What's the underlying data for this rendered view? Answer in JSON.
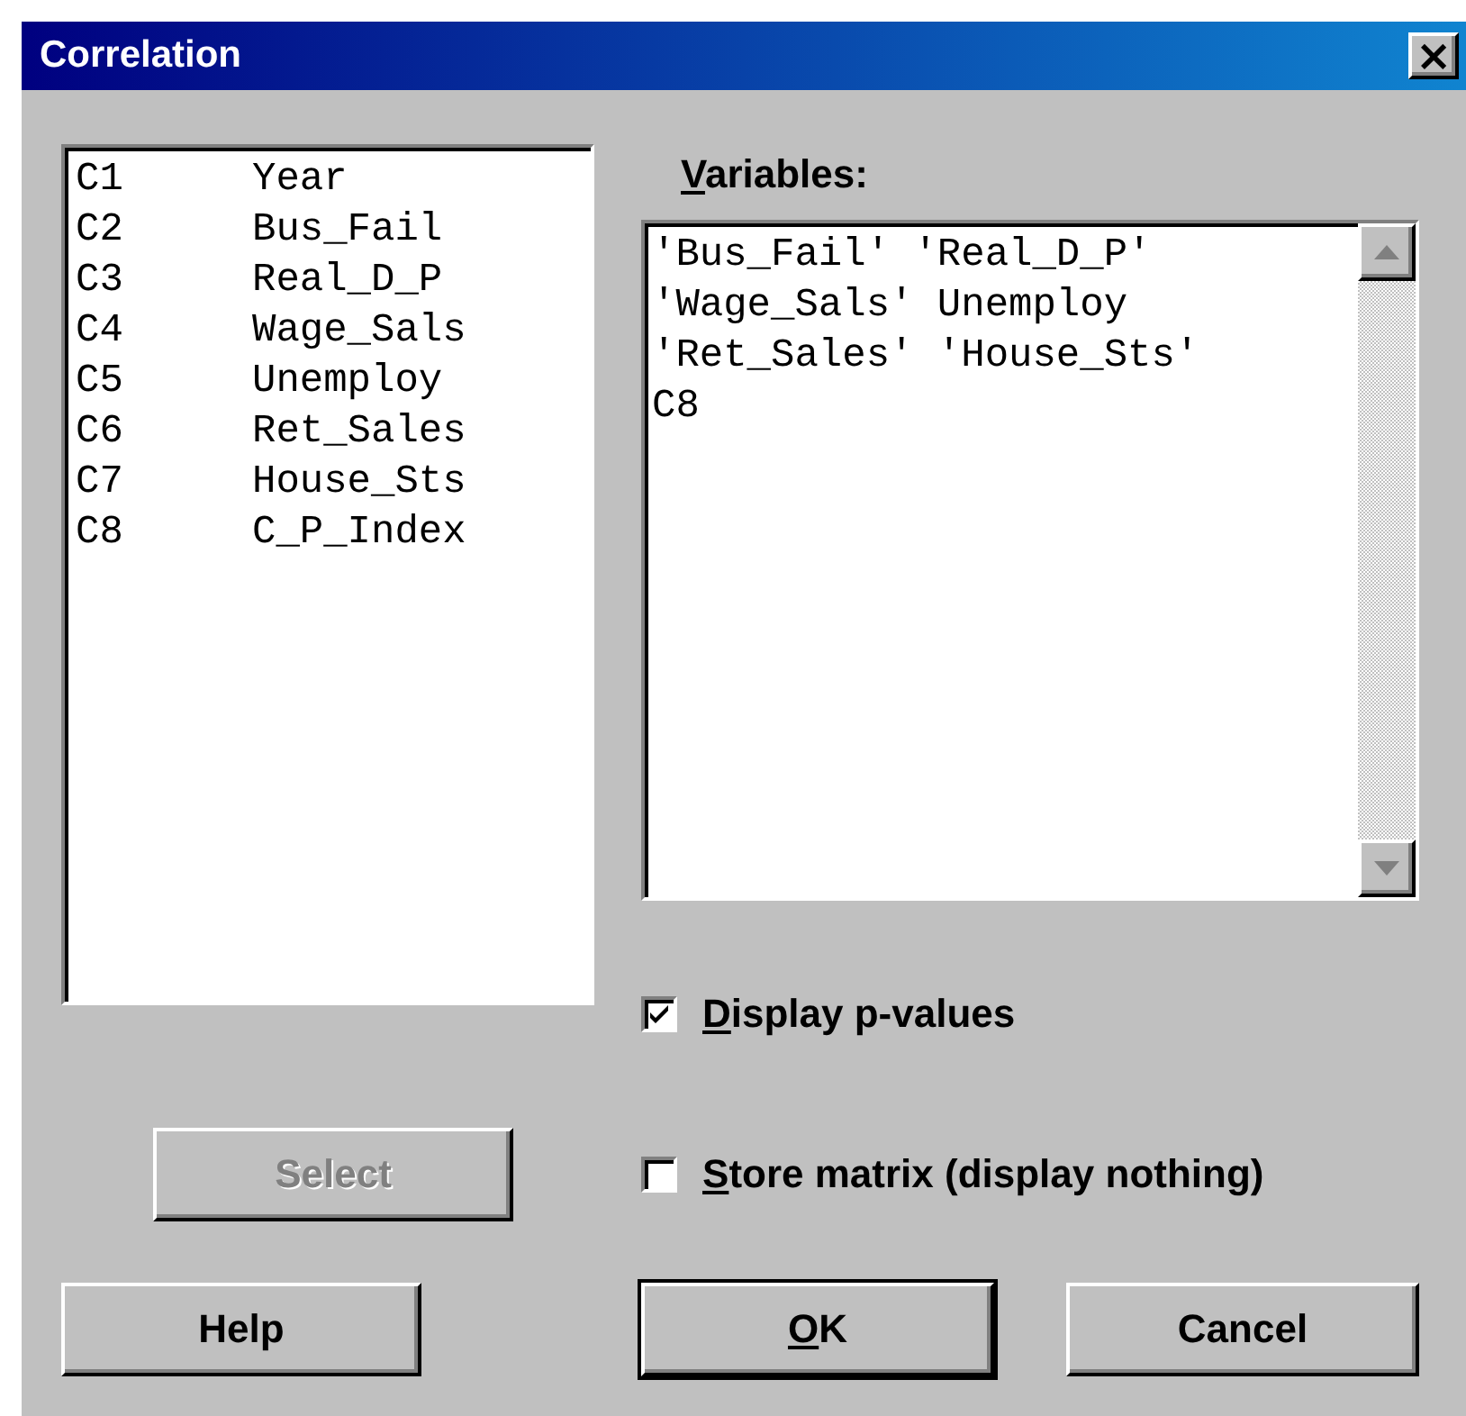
{
  "window": {
    "title": "Correlation",
    "close_label": "×"
  },
  "columns_list": [
    {
      "id": "C1",
      "name": "Year"
    },
    {
      "id": "C2",
      "name": "Bus_Fail"
    },
    {
      "id": "C3",
      "name": "Real_D_P"
    },
    {
      "id": "C4",
      "name": "Wage_Sals"
    },
    {
      "id": "C5",
      "name": "Unemploy"
    },
    {
      "id": "C6",
      "name": "Ret_Sales"
    },
    {
      "id": "C7",
      "name": "House_Sts"
    },
    {
      "id": "C8",
      "name": "C_P_Index"
    }
  ],
  "variables": {
    "label": "Variables:",
    "mnemonic": true,
    "value": "'Bus_Fail' 'Real_D_P'\n'Wage_Sals' Unemploy\n'Ret_Sales' 'House_Sts'\nC8"
  },
  "options": [
    {
      "label": "Display p-values",
      "checked": true,
      "mnemonic": true
    },
    {
      "label": "Store matrix (display nothing)",
      "checked": false,
      "mnemonic": true
    }
  ],
  "select_button": {
    "label": "Select",
    "disabled": true
  },
  "buttons": [
    {
      "label": "Help",
      "default": false,
      "mnemonic": false
    },
    {
      "label": "OK",
      "default": true,
      "mnemonic": true
    },
    {
      "label": "Cancel",
      "default": false,
      "mnemonic": false
    }
  ]
}
